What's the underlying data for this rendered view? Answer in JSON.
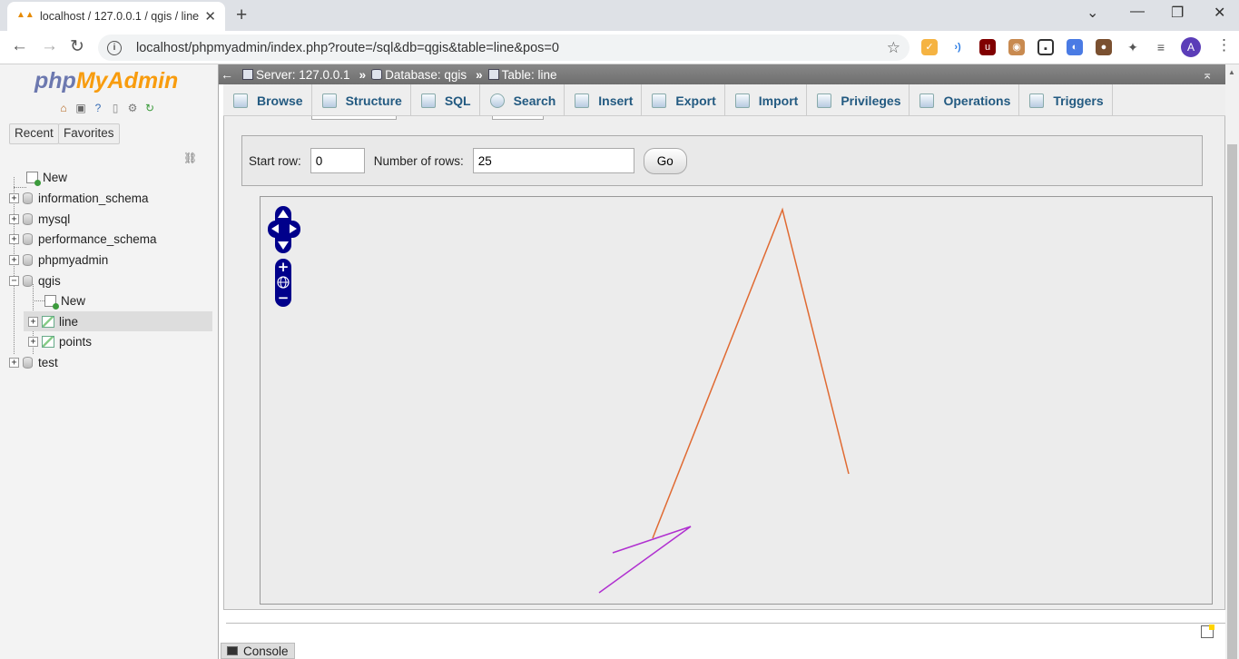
{
  "browser": {
    "tab_title": "localhost / 127.0.0.1 / qgis / line",
    "url": "localhost/phpmyadmin/index.php?route=/sql&db=qgis&table=line&pos=0",
    "avatar_letter": "A"
  },
  "sidebar": {
    "logo_php": "php",
    "logo_myadmin": "MyAdmin",
    "recent_label": "Recent",
    "favorites_label": "Favorites",
    "tree": [
      {
        "label": "New",
        "kind": "new"
      },
      {
        "label": "information_schema",
        "kind": "db"
      },
      {
        "label": "mysql",
        "kind": "db"
      },
      {
        "label": "performance_schema",
        "kind": "db"
      },
      {
        "label": "phpmyadmin",
        "kind": "db"
      },
      {
        "label": "qgis",
        "kind": "db",
        "expanded": true
      },
      {
        "label": "New",
        "kind": "new"
      },
      {
        "label": "line",
        "kind": "table",
        "selected": true
      },
      {
        "label": "points",
        "kind": "table"
      },
      {
        "label": "test",
        "kind": "db"
      }
    ]
  },
  "breadcrumb": {
    "server": "Server: 127.0.0.1",
    "database": "Database: qgis",
    "table": "Table: line"
  },
  "tabs": [
    "Browse",
    "Structure",
    "SQL",
    "Search",
    "Insert",
    "Export",
    "Import",
    "Privileges",
    "Operations",
    "Triggers"
  ],
  "pager": {
    "start_row_label": "Start row:",
    "start_row_value": "0",
    "num_rows_label": "Number of rows:",
    "num_rows_value": "25",
    "go_label": "Go"
  },
  "map": {
    "geometries": [
      {
        "color": "#e06a32"
      },
      {
        "color": "#b030d0"
      }
    ]
  },
  "console_label": "Console"
}
